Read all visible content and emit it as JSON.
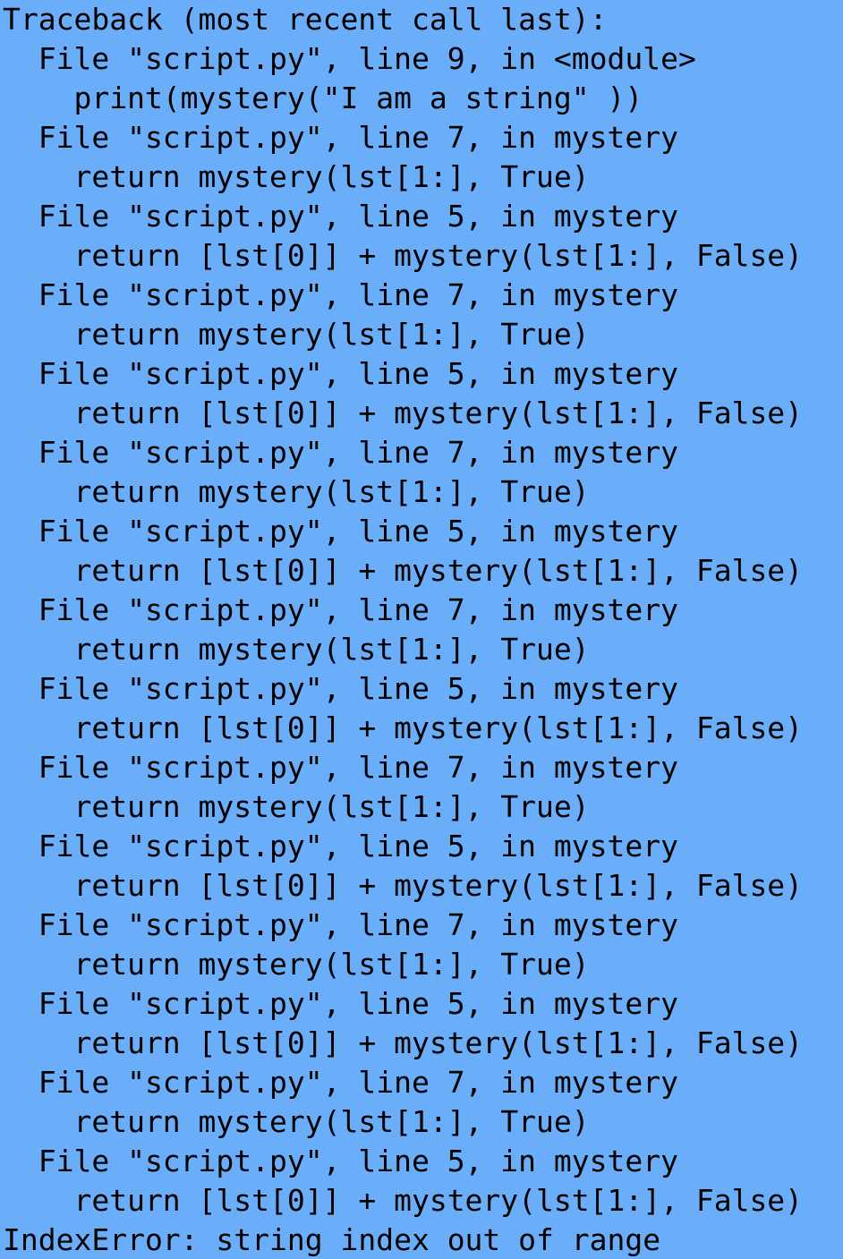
{
  "terminal": {
    "background_color": "#6aaefa",
    "text_color": "#000000",
    "lines": [
      "Traceback (most recent call last):",
      "  File \"script.py\", line 9, in <module>",
      "    print(mystery(\"I am a string\" ))",
      "  File \"script.py\", line 7, in mystery",
      "    return mystery(lst[1:], True)",
      "  File \"script.py\", line 5, in mystery",
      "    return [lst[0]] + mystery(lst[1:], False)",
      "  File \"script.py\", line 7, in mystery",
      "    return mystery(lst[1:], True)",
      "  File \"script.py\", line 5, in mystery",
      "    return [lst[0]] + mystery(lst[1:], False)",
      "  File \"script.py\", line 7, in mystery",
      "    return mystery(lst[1:], True)",
      "  File \"script.py\", line 5, in mystery",
      "    return [lst[0]] + mystery(lst[1:], False)",
      "  File \"script.py\", line 7, in mystery",
      "    return mystery(lst[1:], True)",
      "  File \"script.py\", line 5, in mystery",
      "    return [lst[0]] + mystery(lst[1:], False)",
      "  File \"script.py\", line 7, in mystery",
      "    return mystery(lst[1:], True)",
      "  File \"script.py\", line 5, in mystery",
      "    return [lst[0]] + mystery(lst[1:], False)",
      "  File \"script.py\", line 7, in mystery",
      "    return mystery(lst[1:], True)",
      "  File \"script.py\", line 5, in mystery",
      "    return [lst[0]] + mystery(lst[1:], False)",
      "  File \"script.py\", line 7, in mystery",
      "    return mystery(lst[1:], True)",
      "  File \"script.py\", line 5, in mystery",
      "    return [lst[0]] + mystery(lst[1:], False)",
      "IndexError: string index out of range"
    ]
  }
}
